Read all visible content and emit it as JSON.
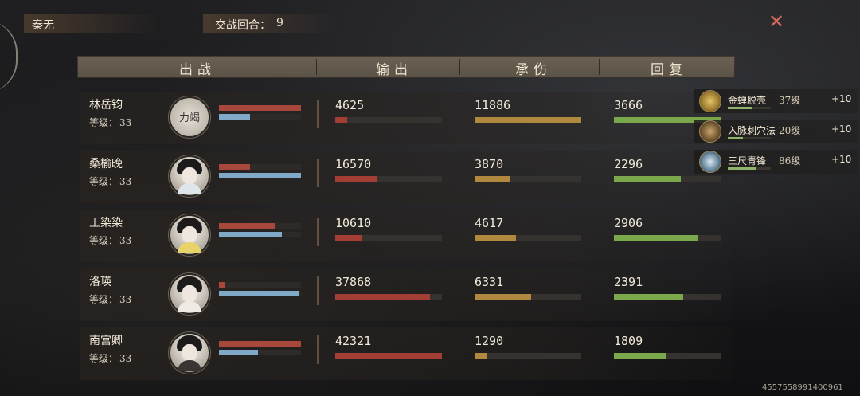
{
  "header_bar": {
    "title": "秦无",
    "round_label": "交战回合：",
    "round_value": "9",
    "close_symbol": "✕"
  },
  "columns": [
    "出战",
    "输出",
    "承伤",
    "回复"
  ],
  "level_label": "等级：",
  "characters": [
    {
      "name": "林岳钧",
      "level": "33",
      "avatar_text": "力竭",
      "hp": 1.0,
      "mp": 0.38,
      "output": "4625",
      "output_ratio": 0.11,
      "damage_taken": "11886",
      "damage_taken_ratio": 1.0,
      "healing": "3666",
      "healing_ratio": 1.0
    },
    {
      "name": "桑榆晚",
      "level": "33",
      "avatar_text": "",
      "hp": 0.38,
      "mp": 1.0,
      "output": "16570",
      "output_ratio": 0.39,
      "damage_taken": "3870",
      "damage_taken_ratio": 0.33,
      "healing": "2296",
      "healing_ratio": 0.63
    },
    {
      "name": "王染染",
      "level": "33",
      "avatar_text": "",
      "hp": 0.68,
      "mp": 0.77,
      "output": "10610",
      "output_ratio": 0.25,
      "damage_taken": "4617",
      "damage_taken_ratio": 0.39,
      "healing": "2906",
      "healing_ratio": 0.79
    },
    {
      "name": "洛瑛",
      "level": "33",
      "avatar_text": "",
      "hp": 0.08,
      "mp": 0.98,
      "output": "37868",
      "output_ratio": 0.89,
      "damage_taken": "6331",
      "damage_taken_ratio": 0.53,
      "healing": "2391",
      "healing_ratio": 0.65
    },
    {
      "name": "南宫卿",
      "level": "33",
      "avatar_text": "",
      "hp": 1.0,
      "mp": 0.48,
      "output": "42321",
      "output_ratio": 1.0,
      "damage_taken": "1290",
      "damage_taken_ratio": 0.11,
      "healing": "1809",
      "healing_ratio": 0.49
    }
  ],
  "skills": [
    {
      "name": "金蝉脱壳",
      "level": "37级",
      "bonus": "+10",
      "progress": 0.55,
      "icon": "golden-cicada-icon"
    },
    {
      "name": "入脉刺穴法",
      "level": "20级",
      "bonus": "+10",
      "progress": 0.35,
      "icon": "acupuncture-icon"
    },
    {
      "name": "三尺青锋",
      "level": "86级",
      "bonus": "+10",
      "progress": 0.65,
      "icon": "sword-icon"
    }
  ],
  "footer_id": "4557558991400961",
  "colors": {
    "output_bar": "#a33e34",
    "damage_taken_bar": "#b0893f",
    "healing_bar": "#7aa84a",
    "hp_bar": "#a8483c",
    "mp_bar": "#7fa9c6",
    "close": "#d8685a"
  }
}
